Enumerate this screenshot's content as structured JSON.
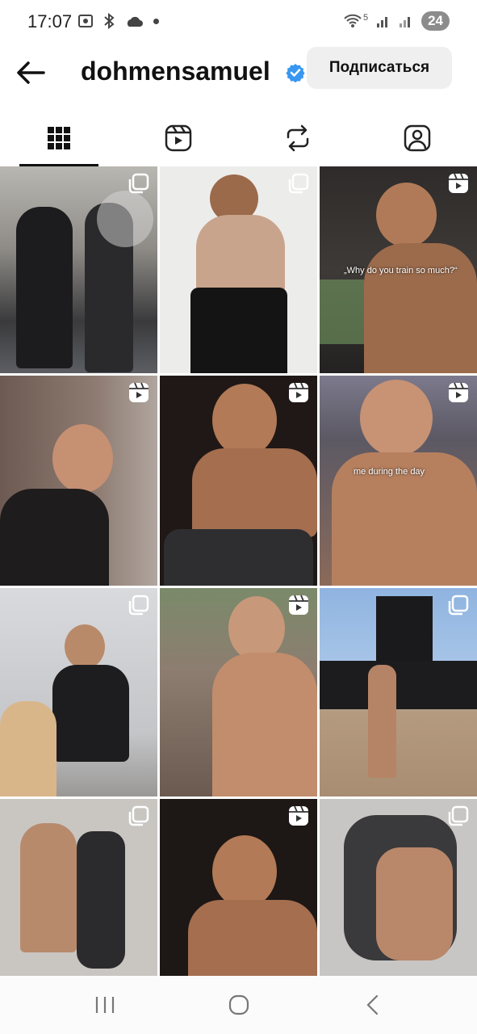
{
  "status_bar": {
    "time": "17:07",
    "network_label": "5",
    "battery": "24"
  },
  "header": {
    "username": "dohmensamuel",
    "follow_button": "Подписаться",
    "verified": true
  },
  "tabs": [
    {
      "name": "grid",
      "icon": "grid-icon",
      "active": true
    },
    {
      "name": "reels",
      "icon": "reels-icon",
      "active": false
    },
    {
      "name": "reposts",
      "icon": "repost-icon",
      "active": false
    },
    {
      "name": "tagged",
      "icon": "tagged-icon",
      "active": false
    }
  ],
  "posts": [
    {
      "type": "carousel",
      "caption": ""
    },
    {
      "type": "carousel",
      "caption": ""
    },
    {
      "type": "reel",
      "caption": "„Why do you train so much?“"
    },
    {
      "type": "reel",
      "caption": ""
    },
    {
      "type": "reel",
      "caption": ""
    },
    {
      "type": "reel",
      "caption": "me during the day"
    },
    {
      "type": "carousel",
      "caption": ""
    },
    {
      "type": "reel",
      "caption": ""
    },
    {
      "type": "carousel",
      "caption": ""
    },
    {
      "type": "carousel",
      "caption": ""
    },
    {
      "type": "reel",
      "caption": ""
    },
    {
      "type": "carousel",
      "caption": ""
    }
  ],
  "colors": {
    "accent_verified": "#3897f0",
    "button_bg": "#efefef",
    "text": "#111111"
  }
}
